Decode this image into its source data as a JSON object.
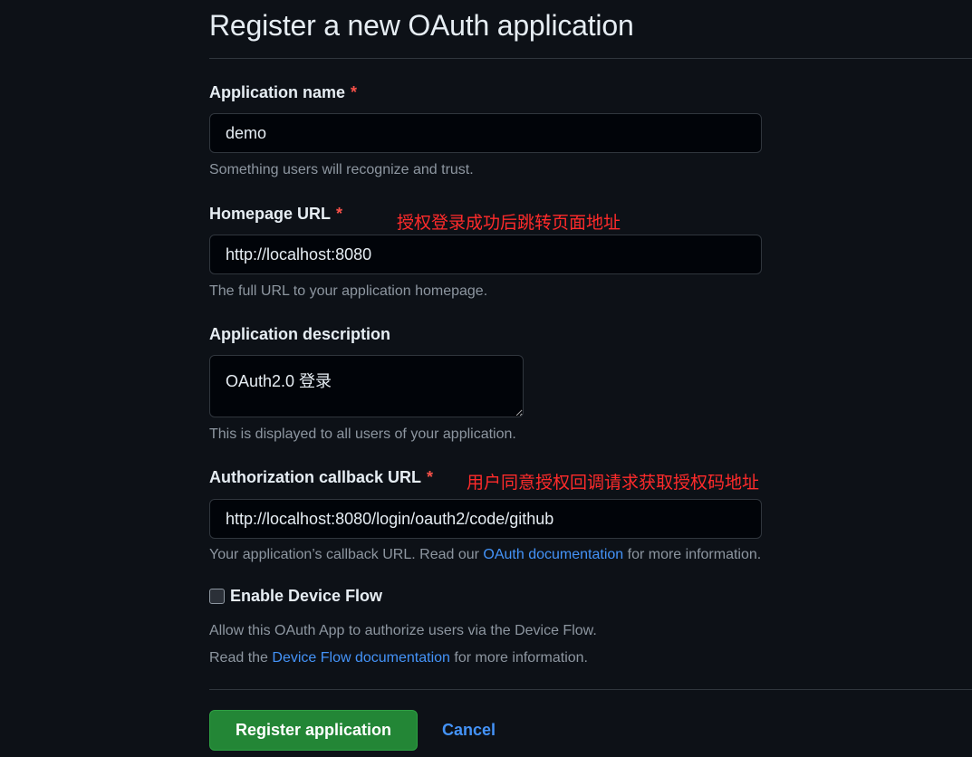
{
  "page": {
    "title": "Register a new OAuth application"
  },
  "form": {
    "app_name": {
      "label": "Application name",
      "required": "*",
      "value": "demo",
      "hint": "Something users will recognize and trust."
    },
    "homepage_url": {
      "label": "Homepage URL",
      "required": "*",
      "annotation": "授权登录成功后跳转页面地址",
      "value": "http://localhost:8080",
      "hint": "The full URL to your application homepage."
    },
    "description": {
      "label": "Application description",
      "value": "OAuth2.0 登录",
      "hint": "This is displayed to all users of your application."
    },
    "callback_url": {
      "label": "Authorization callback URL",
      "required": "*",
      "annotation": "用户同意授权回调请求获取授权码地址",
      "value": "http://localhost:8080/login/oauth2/code/github",
      "hint_prefix": "Your application’s callback URL. Read our ",
      "hint_link": "OAuth documentation",
      "hint_suffix": " for more information."
    },
    "device_flow": {
      "label": "Enable Device Flow",
      "checked": false,
      "desc_line1": "Allow this OAuth App to authorize users via the Device Flow.",
      "desc_line2_prefix": "Read the ",
      "desc_line2_link": "Device Flow documentation",
      "desc_line2_suffix": " for more information."
    }
  },
  "actions": {
    "register_label": "Register application",
    "cancel_label": "Cancel"
  },
  "colors": {
    "background": "#0d1117",
    "required": "#f85149",
    "annotation": "#ff2b2b",
    "link": "#4493f8",
    "primary_button": "#238636"
  }
}
